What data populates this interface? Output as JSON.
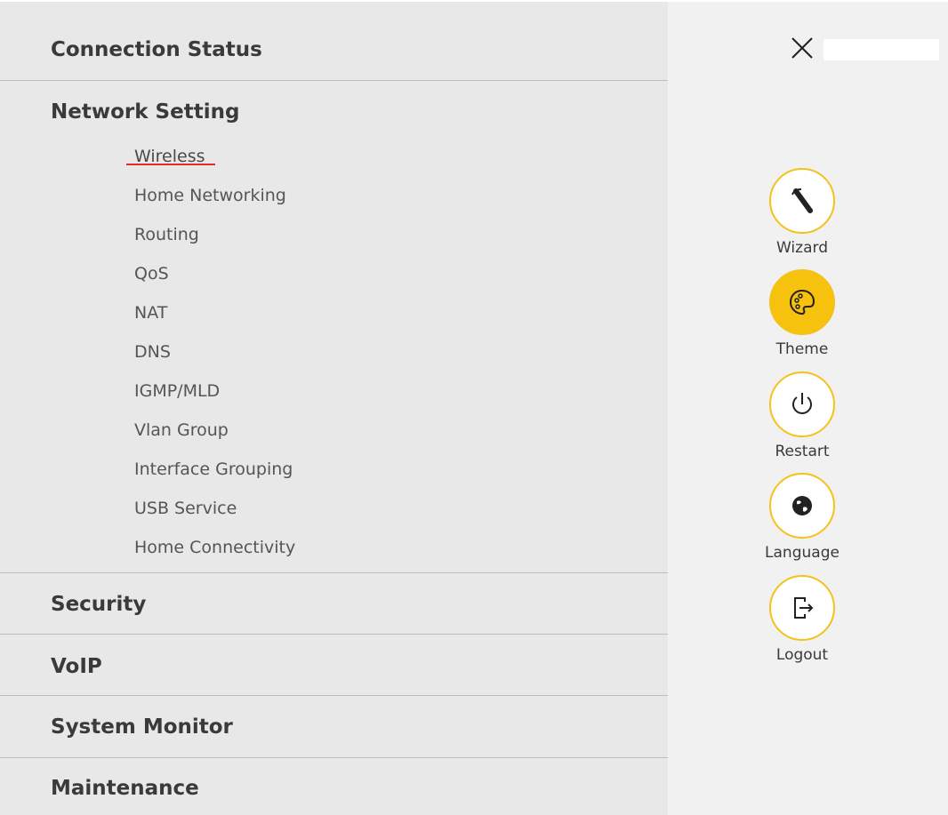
{
  "menu": {
    "connection_status": "Connection Status",
    "network_setting": "Network Setting",
    "network_items": [
      "Wireless",
      "Home Networking",
      "Routing",
      "QoS",
      "NAT",
      "DNS",
      "IGMP/MLD",
      "Vlan Group",
      "Interface Grouping",
      "USB Service",
      "Home Connectivity"
    ],
    "active_item": "Wireless",
    "security": "Security",
    "voip": "VoIP",
    "system_monitor": "System Monitor",
    "maintenance": "Maintenance"
  },
  "actions": {
    "wizard": "Wizard",
    "theme": "Theme",
    "restart": "Restart",
    "language": "Language",
    "logout": "Logout"
  },
  "colors": {
    "accent_yellow": "#f3c21b",
    "active_underline": "#e52a2a"
  },
  "icons": [
    "close-icon",
    "wizard-icon",
    "palette-icon",
    "power-icon",
    "globe-icon",
    "logout-icon"
  ]
}
